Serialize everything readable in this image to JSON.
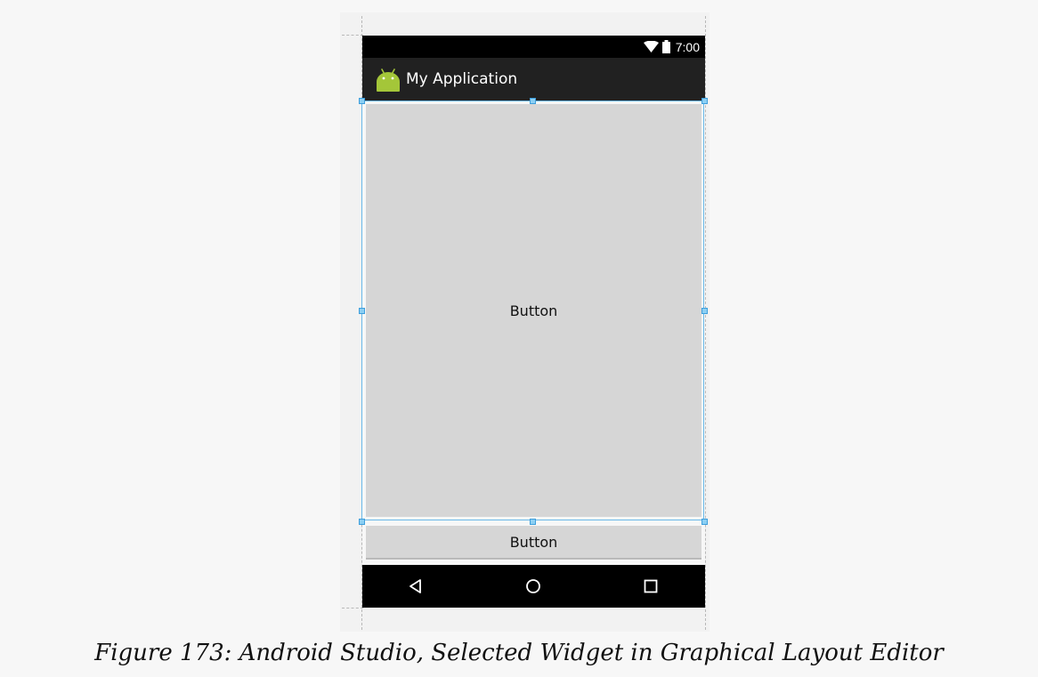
{
  "status_bar": {
    "time": "7:00",
    "wifi_icon": "wifi-icon",
    "battery_icon": "battery-icon"
  },
  "action_bar": {
    "app_icon": "android-icon",
    "title": "My Application"
  },
  "layout": {
    "large_button_label": "Button",
    "small_button_label": "Button"
  },
  "nav_bar": {
    "back_icon": "back-triangle-icon",
    "home_icon": "home-circle-icon",
    "recents_icon": "recents-square-icon"
  },
  "caption": "Figure 173: Android Studio, Selected Widget in Graphical Layout Editor",
  "colors": {
    "selection": "#69b8e8",
    "action_bar": "#212121",
    "button_bg": "#d6d6d6",
    "android_green": "#a4c639"
  }
}
